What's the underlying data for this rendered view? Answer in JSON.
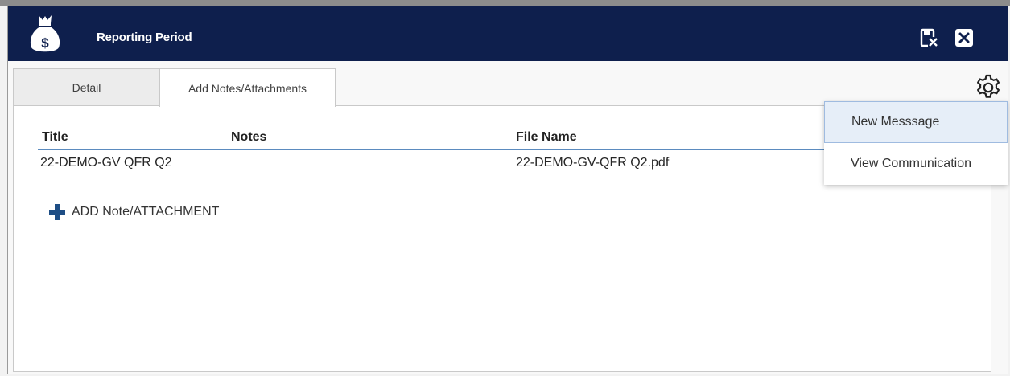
{
  "window": {
    "title": "Reporting Period",
    "icons": {
      "logo": "money-bag-icon",
      "save_close": "save-close-icon",
      "close": "close-icon",
      "settings": "gear-icon"
    }
  },
  "tabs": [
    {
      "label": "Detail",
      "selected": false
    },
    {
      "label": "Add Notes/Attachments",
      "selected": true
    }
  ],
  "table": {
    "columns": [
      "Title",
      "Notes",
      "File Name"
    ],
    "rows": [
      {
        "title": "22-DEMO-GV QFR Q2",
        "notes": "",
        "file_name": "22-DEMO-GV-QFR Q2.pdf"
      }
    ]
  },
  "add_button_label": "ADD Note/ATTACHMENT",
  "settings_menu": {
    "items": [
      {
        "label": "New Messsage",
        "highlighted": true
      },
      {
        "label": "View Communication",
        "highlighted": false
      }
    ]
  },
  "colors": {
    "titlebar": "#0e1f4d",
    "accent": "#1e4e85",
    "header_underline": "#5b8bbf",
    "menu_highlight": "#e6eef8"
  }
}
